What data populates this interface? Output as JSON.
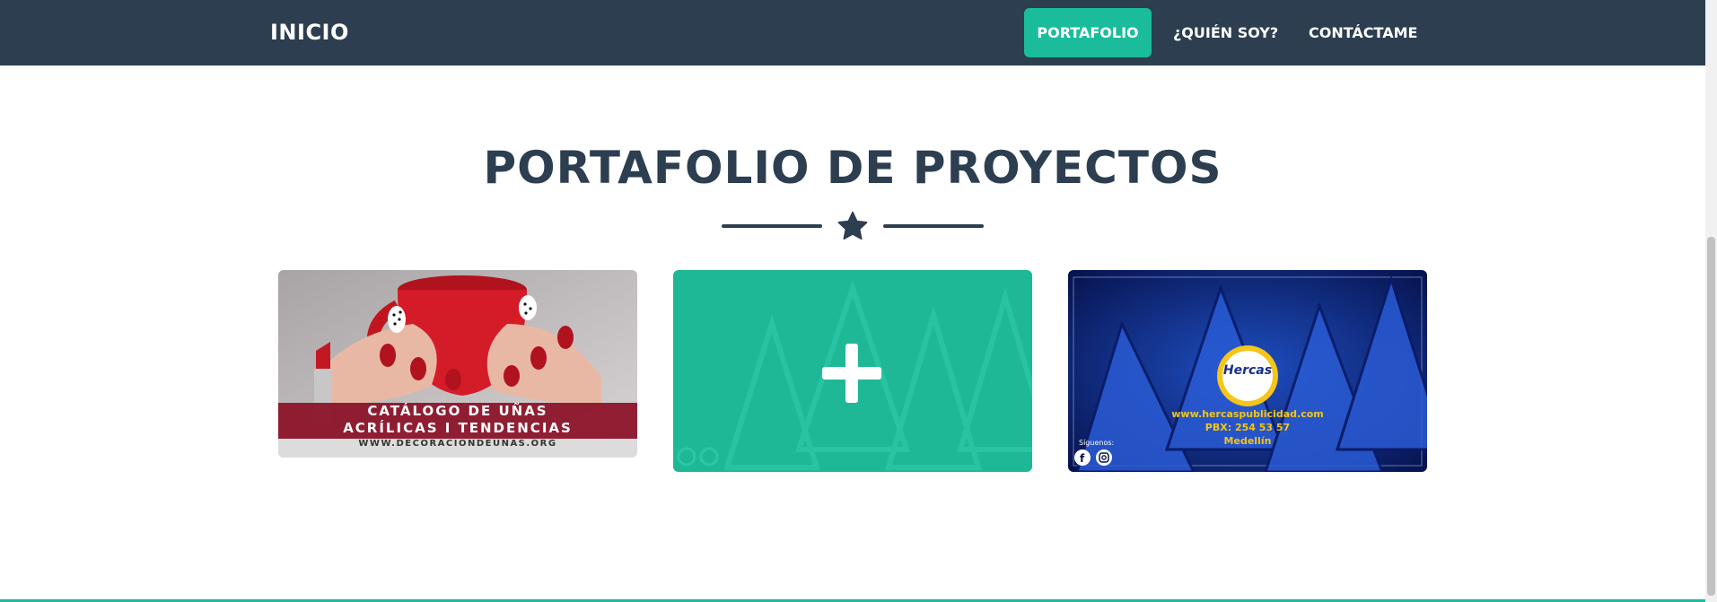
{
  "navbar": {
    "brand": "INICIO",
    "links": [
      {
        "label": "PORTAFOLIO",
        "active": true
      },
      {
        "label": "¿QUIÉN SOY?",
        "active": false
      },
      {
        "label": "CONTÁCTAME",
        "active": false
      }
    ]
  },
  "section": {
    "title": "PORTAFOLIO DE PROYECTOS",
    "divider_icon": "star-icon"
  },
  "projects": [
    {
      "caption_line1": "CATÁLOGO DE UÑAS",
      "caption_line2": "ACRÍLICAS I TENDENCIAS",
      "caption_url": "WWW.DECORACIONDEUNAS.ORG"
    },
    {
      "overlay_icon": "plus-icon"
    },
    {
      "logo_text": "Hercas",
      "url": "www.hercaspublicidad.com",
      "phone": "PBX: 254 53 57",
      "city": "Medellín",
      "follow_label": "Síguenos:",
      "social_icons": [
        "facebook-icon",
        "instagram-icon"
      ]
    }
  ],
  "colors": {
    "navbar_bg": "#2c3e50",
    "accent": "#1abc9c",
    "title": "#2c3e50",
    "hercas_yellow": "#f5c518"
  }
}
